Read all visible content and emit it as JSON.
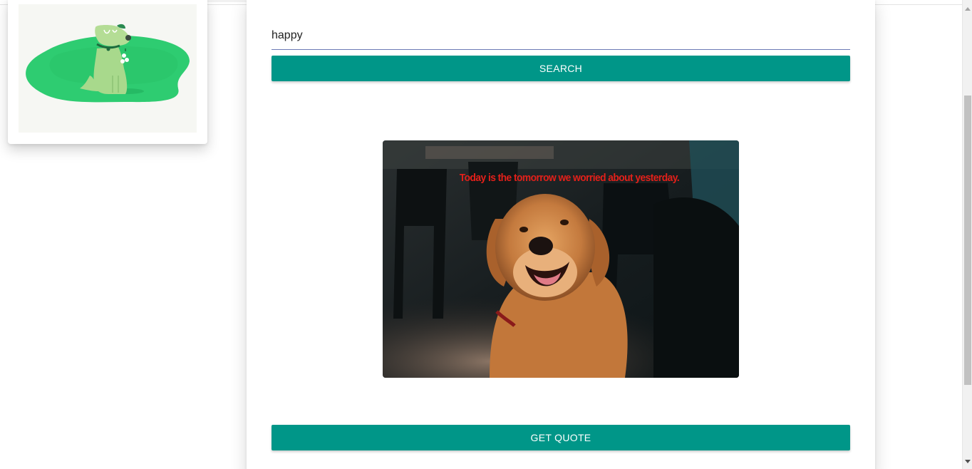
{
  "search": {
    "value": "happy",
    "button_label": "SEARCH"
  },
  "illustration": {
    "icon": "dog-on-green-blob-illustration"
  },
  "photo": {
    "icon": "golden-retriever-photo",
    "quote": "Today is the tomorrow we worried about yesterday."
  },
  "actions": {
    "get_quote_label": "GET QUOTE"
  },
  "colors": {
    "accent": "#009688",
    "quote_text": "#e3201a",
    "blob_green": "#2ecc71"
  }
}
